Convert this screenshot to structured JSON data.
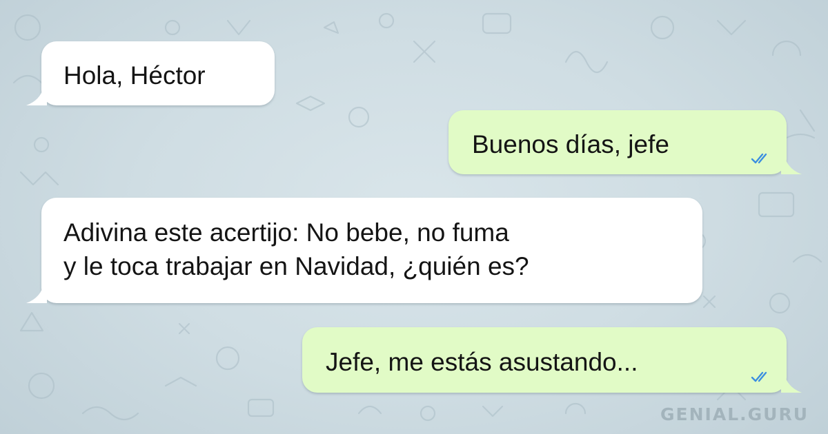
{
  "colors": {
    "background": "#c9d8df",
    "incoming_bubble": "#ffffff",
    "outgoing_bubble": "#e1fbc6",
    "read_ticks": "#3b8ee0"
  },
  "messages": [
    {
      "direction": "incoming",
      "text": "Hola, Héctor"
    },
    {
      "direction": "outgoing",
      "text": "Buenos días, jefe",
      "status_icon": "double-check-icon"
    },
    {
      "direction": "incoming",
      "text": "Adivina este acertijo: No bebe, no fuma\ny le toca trabajar en Navidad, ¿quién es?"
    },
    {
      "direction": "outgoing",
      "text": "Jefe, me estás asustando...",
      "status_icon": "double-check-icon"
    }
  ],
  "watermark": "GENIAL.GURU"
}
